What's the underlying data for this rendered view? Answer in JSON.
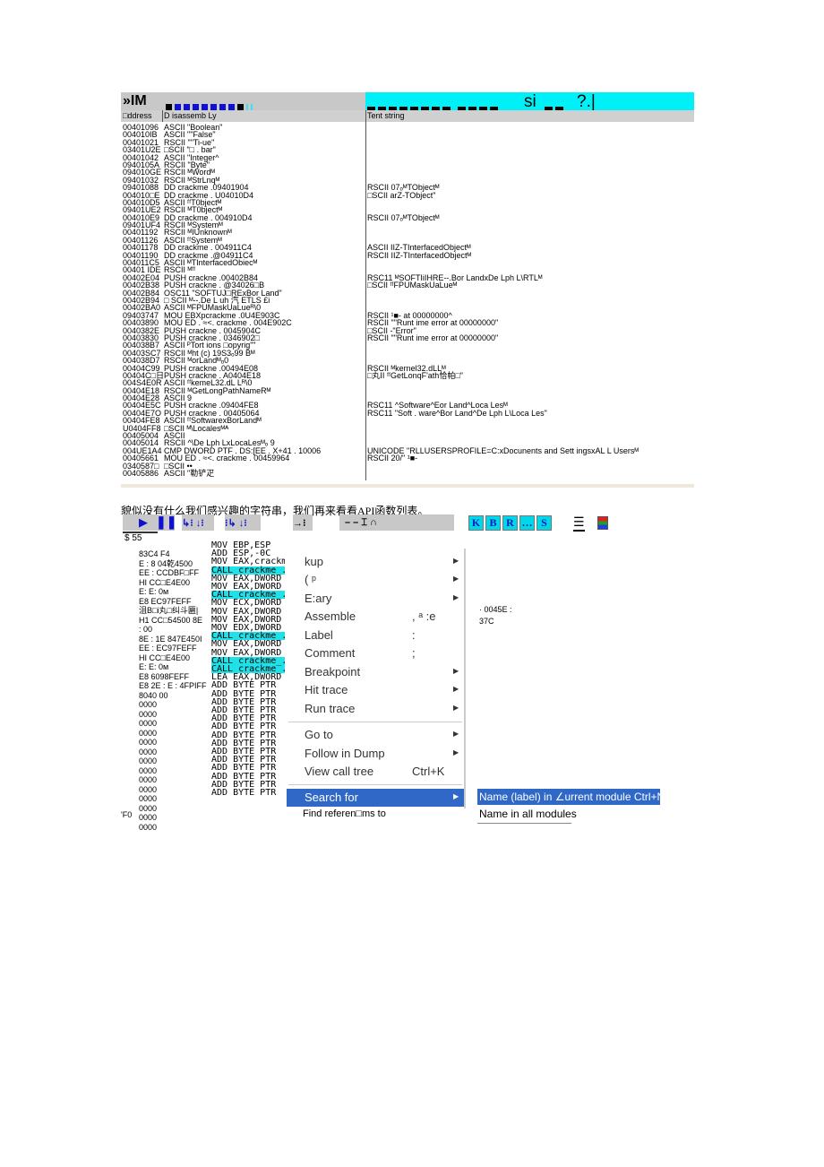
{
  "table": {
    "logo": "»IM",
    "header_right_text": "si",
    "header_right_tail": "?.|",
    "accent": "#00f0f8",
    "columns": [
      "□ddress",
      "D isassemb Ly",
      "Tent string"
    ],
    "rows": [
      [
        "00401096",
        "ASCII \"Boolean\"",
        ""
      ],
      [
        "004010IB",
        "ASCII \"\"False\"",
        ""
      ],
      [
        "00401021",
        "RSCII \"\"Ti-ue\"",
        ""
      ],
      [
        "03401U2E",
        "□SCII \"□ . bar\"",
        ""
      ],
      [
        "00401042",
        "ASCII \"Integer^",
        ""
      ],
      [
        "0940105A",
        "RSCII \"Byte\"",
        ""
      ],
      [
        "094010GE",
        "RSCII ᴹWordᴹ",
        ""
      ],
      [
        "09401032",
        "RSCII ᴹStrLnqᴹ",
        ""
      ],
      [
        "09401088",
        "DD crackme .09401904",
        "RSCII 07ₒᴹTObjectᴹ"
      ],
      [
        "004010□E",
        "DD crackme . U04010D4",
        "□SCII arZ-TObject\""
      ],
      [
        "004010D5",
        "ASCII ᶠᶠT0bjectᴹ",
        ""
      ],
      [
        "09401UE2",
        "RSCII ᴹT0bjectᴹ",
        ""
      ],
      [
        "004010E9",
        "DD crackme . 004910D4",
        "RSCII 07ₒᴹTObjectᴹ"
      ],
      [
        "09401UF4",
        "RSCII ᴹSystemᴹ",
        ""
      ],
      [
        "00401192",
        "RSCII ᴹIUnknownᴹ",
        ""
      ],
      [
        "00401126",
        "ASCII ᶠᶠSystemᴹ",
        ""
      ],
      [
        "00401178",
        "DD crackme . 004911C4",
        "ASCII IIZ-TInterfacedObjectᴹ"
      ],
      [
        "00401190",
        "DD crackme .@04911C4",
        "RSCII IIZ-TInterfacedObjectᴹ"
      ],
      [
        "004011C5",
        "ASCII ᴹTInterfacedObiecᴹ",
        ""
      ],
      [
        "00401 IDE",
        "RSCII ᴹᶠᶠ",
        ""
      ],
      [
        "00402E04",
        "PUSH crackne .00402B84",
        "RSC11 ᴹSOFTIiIHRE--.Bor LandxDe Lph L\\RTLᴹ"
      ],
      [
        "00402B38",
        "PUSH crackne . @34026□B",
        "□SCII ᶠᶠFPUMaskUaLueᴹ"
      ],
      [
        "00402B84",
        "OSC11 \"SOFTUJ□RExBor Land\"",
        ""
      ],
      [
        "00402B94",
        "□ SCII ᴹ--.De L uh 汽 ETLS £i",
        ""
      ],
      [
        "00402BA0",
        "ASCII ᴹFPUMaskUaLueᴿ\\0",
        ""
      ],
      [
        "09403747",
        "MOU EBXpcrackme .0U4E903C",
        "RSCII ¹■- at 00000000^"
      ],
      [
        "00403890",
        "MOU ED . ≈<. crackme . 004E902C",
        "RSCII \"\"Runt ime error                  at 00000000\""
      ],
      [
        "0040382E",
        "PUSH crackne . 0045904C",
        "□SCII -\"Error\""
      ],
      [
        "00403830",
        "PUSH crackne . 0346902□",
        "RSCII \"\"Runt ime error                  at 00000000\""
      ],
      [
        "004038B7",
        "ASCII ᴾTort ions □opyrig\"\"",
        ""
      ],
      [
        "00403SC7",
        "RSCII ᴹht (c) 19S3ₒ99 Bᴹ",
        ""
      ],
      [
        "004038D7",
        "RSCII ᴹorLandᴹₒ0",
        ""
      ],
      [
        "00404C99",
        "PUSH crackne .00494E08",
        "RSCII ᴹkernel32.dLLᴹ"
      ],
      [
        "00404C□日",
        "PUSH crackne . A0404E18",
        "□丸II ᶠᶠGetLonqF'ath恰帕□\""
      ],
      [
        "004S4E0R",
        "ASCII ᶠᶠkemeL32.dL Lᴿ\\0",
        ""
      ],
      [
        "00404E18",
        "RSCII ᴹGetLongPathNameRᴹ",
        ""
      ],
      [
        "00404E28",
        "ASCII 9",
        ""
      ],
      [
        "00404E5C",
        "PUSH crackne .09404FE8",
        "RSC11 ^Software^Eor Land^Loca Lesᴹ"
      ],
      [
        "00404E7O",
        "PUSH crackne . 00405064",
        "RSC11 \"Soft . ware^Bor Land^De Lph L\\Loca Les\""
      ],
      [
        "00404FE8",
        "ASCII ᶠᶠSoftwarexBorLandᴹ",
        ""
      ],
      [
        "U0404FF8",
        "□SCII ᴹ\\Localesᴹᴬ",
        ""
      ],
      [
        "00405004",
        "ASCII",
        ""
      ],
      [
        "00405014",
        "RSCII ^\\De Lph LxLocaLesᴹₒ 9",
        ""
      ],
      [
        "004UE1A4",
        "CMP DWORD PTF . DS:[EE . X+41 . 10006",
        "UNICODE \"RLLUSERSPROFILE=C:xDocunents and Sett ingsxAL L Usersᴹ"
      ],
      [
        "00405661",
        "MOU ED . ≈<. crackme . 00459964",
        "RSCII 20/\"                                        ¹■-"
      ],
      [
        "0340587□",
        "□SCII ••",
        ""
      ],
      [
        "00405886",
        "ASCII \"勒铲疋",
        ""
      ]
    ]
  },
  "paragraph": "貌似没有什么我们感兴趣的字符串，我们再来看看API函数列表。",
  "toolbar": {
    "letters": [
      "K",
      "B",
      "R",
      "…",
      "S"
    ],
    "symbols": "–  –  ⌶  ∩",
    "status": "$ 55"
  },
  "hex_column": [
    "83C4 F4",
    "E : 8    04乾4500",
    "EE : CCDBF□FF",
    "HI CC□E4E00",
    "E: E: 0м",
    "E8 EC97FEFF",
    "沮B□i丸□纠斗匾|",
    "H1 CC□54500 8E",
    ": 00",
    "8E : 1E 847E450I",
    "EE : EC97FEFF",
    "HI CC□E4E00",
    "E: E: 0м",
    "E8 6098FEFF",
    "E8 2E : E : 4FPIFF",
    "8040 00",
    "0000",
    "0000",
    "0000",
    "0000",
    "0000",
    "0000",
    "0000",
    "0000",
    "0000",
    "0000",
    "0000",
    "0000",
    "0000",
    "0000"
  ],
  "hex_footer": "'F0",
  "disasm_column": [
    [
      "MOV EBP,ESP",
      0
    ],
    [
      "ADD ESP,-0C",
      0
    ],
    [
      "MOV EAX,crackm",
      0
    ],
    [
      "CALL crackme_.",
      1
    ],
    [
      "MOV EAX,DWORD",
      0
    ],
    [
      "MOV EAX,DWORD",
      0
    ],
    [
      "CALL crackme_.",
      1
    ],
    [
      "MOV ECX,DWORD",
      0
    ],
    [
      "MOV EAX,DWORD",
      0
    ],
    [
      "MOV EAX,DWORD",
      0
    ],
    [
      "MOV EDX,DWORD",
      0
    ],
    [
      "CALL crackme_.",
      1
    ],
    [
      "MOV EAX,DWORD",
      0
    ],
    [
      "MOV EAX,DWORD",
      0
    ],
    [
      "CALL crackme_.",
      1
    ],
    [
      "CALL crackme_.",
      1
    ],
    [
      "LEA EAX,DWORD",
      0
    ],
    [
      "ADD BYTE PTR",
      0
    ],
    [
      "ADD BYTE PTR",
      0
    ],
    [
      "ADD BYTE PTR",
      0
    ],
    [
      "ADD BYTE PTR",
      0
    ],
    [
      "ADD BYTE PTR",
      0
    ],
    [
      "ADD BYTE PTR",
      0
    ],
    [
      "ADD BYTE PTR",
      0
    ],
    [
      "ADD BYTE PTR",
      0
    ],
    [
      "ADD BYTE PTR",
      0
    ],
    [
      "ADD BYTE PTR",
      0
    ],
    [
      "ADD BYTE PTR",
      0
    ],
    [
      "ADD BYTE PTR",
      0
    ],
    [
      "ADD BYTE PTR",
      0
    ],
    [
      "ADD BYTE PTR",
      0
    ]
  ],
  "side_text": [
    "· 0045E :",
    "37C"
  ],
  "context_menu": {
    "items": [
      {
        "label": "kup",
        "shortcut": "",
        "arrow": true
      },
      {
        "label": "( ᵖ",
        "shortcut": "",
        "arrow": true
      },
      {
        "label": "E:ary",
        "shortcut": "",
        "arrow": true
      },
      {
        "label": "Assemble",
        "shortcut": ", ᵃ :e",
        "arrow": false
      },
      {
        "label": "Label",
        "shortcut": ":",
        "arrow": false
      },
      {
        "label": "Comment",
        "shortcut": ";",
        "arrow": false
      },
      {
        "label": "Breakpoint",
        "shortcut": "",
        "arrow": true
      },
      {
        "label": "Hit trace",
        "shortcut": "",
        "arrow": true
      },
      {
        "label": "Run trace",
        "shortcut": "",
        "arrow": true
      },
      {
        "label": "Go to",
        "shortcut": "",
        "arrow": true
      },
      {
        "label": "Follow in Dump",
        "shortcut": "",
        "arrow": true
      },
      {
        "label": "View call tree",
        "shortcut": "Ctrl+K",
        "arrow": false
      },
      {
        "label": "Search for",
        "shortcut": "",
        "arrow": true
      },
      {
        "label": "Find referen□ms to",
        "shortcut": "",
        "arrow": false
      }
    ],
    "highlight": "#3068c8",
    "submenu": [
      "Name (label) in ∠urrent module Ctrl+N",
      "Name in all modules"
    ]
  }
}
